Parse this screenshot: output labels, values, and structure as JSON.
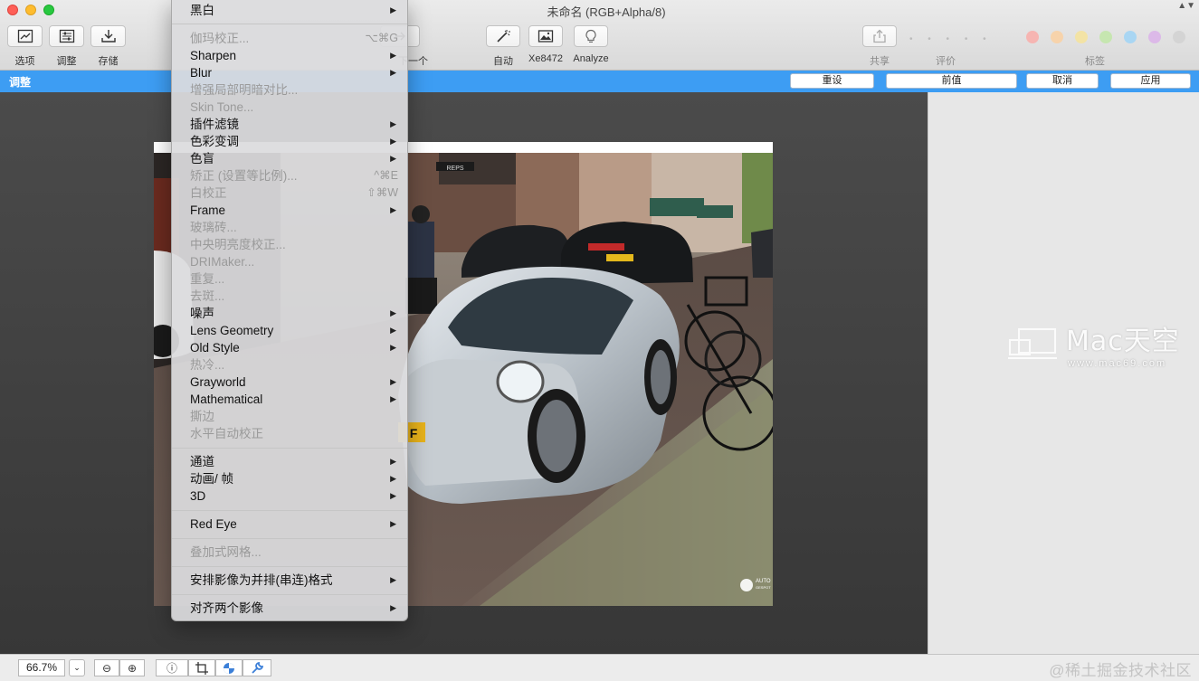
{
  "window": {
    "title": "未命名 (RGB+Alpha/8)",
    "scroll_arrows": "▲▼"
  },
  "toolbar": {
    "options_label": "选项",
    "adjust_label": "调整",
    "save_label": "存储",
    "next_label": "下一个",
    "auto_label": "自动",
    "xe_label": "Xe8472",
    "analyze_label": "Analyze",
    "share_label": "共享",
    "rating_label": "评价",
    "rating_dots": "• • • • •",
    "tags_label": "标签",
    "tag_colors": [
      "#f6b5b2",
      "#f7d3ab",
      "#f3e3a5",
      "#c6e6b0",
      "#a9d6f3",
      "#dcb9e8",
      "#d4d4d4"
    ]
  },
  "adjust_bar": {
    "title": "调整",
    "reset_label": "重设",
    "previous_label": "前值",
    "cancel_label": "取消",
    "apply_label": "应用"
  },
  "menu": {
    "items": [
      {
        "label": "黑白",
        "arrow": "▶",
        "disabled": false
      },
      {
        "label": "伽玛校正...",
        "shortcut": "⌥⌘G",
        "disabled": true
      },
      {
        "label": "Sharpen",
        "arrow": "▶",
        "disabled": false
      },
      {
        "label": "Blur",
        "arrow": "▶",
        "disabled": false
      },
      {
        "label": "增强局部明暗对比...",
        "disabled": true
      },
      {
        "label": "Skin Tone...",
        "disabled": true
      },
      {
        "label": "插件滤镜",
        "arrow": "▶",
        "disabled": false
      },
      {
        "label": "色彩变调",
        "arrow": "▶",
        "disabled": false
      },
      {
        "label": "色盲",
        "arrow": "▶",
        "disabled": false
      },
      {
        "label": "矫正 (设置等比例)...",
        "shortcut": "^⌘E",
        "disabled": true
      },
      {
        "label": "白校正",
        "shortcut": "⇧⌘W",
        "disabled": true
      },
      {
        "label": "Frame",
        "arrow": "▶",
        "disabled": false
      },
      {
        "label": "玻璃砖...",
        "disabled": true
      },
      {
        "label": "中央明亮度校正...",
        "disabled": true
      },
      {
        "label": "DRIMaker...",
        "disabled": true
      },
      {
        "label": "重复...",
        "disabled": true
      },
      {
        "label": "去斑...",
        "disabled": true
      },
      {
        "label": "噪声",
        "arrow": "▶",
        "disabled": false
      },
      {
        "label": "Lens Geometry",
        "arrow": "▶",
        "disabled": false
      },
      {
        "label": "Old Style",
        "arrow": "▶",
        "disabled": false
      },
      {
        "label": "热冷...",
        "disabled": true
      },
      {
        "label": "Grayworld",
        "arrow": "▶",
        "disabled": false
      },
      {
        "label": "Mathematical",
        "arrow": "▶",
        "disabled": false
      },
      {
        "label": "撕边",
        "disabled": true
      },
      {
        "label": "水平自动校正",
        "disabled": true
      },
      {
        "label": "通道",
        "arrow": "▶",
        "disabled": false
      },
      {
        "label": "动画/ 帧",
        "arrow": "▶",
        "disabled": false
      },
      {
        "label": "3D",
        "arrow": "▶",
        "disabled": false
      },
      {
        "label": "Red Eye",
        "arrow": "▶",
        "disabled": false
      },
      {
        "label": "叠加式网格...",
        "disabled": true
      },
      {
        "label": "安排影像为并排(串连)格式",
        "arrow": "▶",
        "disabled": false
      },
      {
        "label": "对齐两个影像",
        "arrow": "▶",
        "disabled": false
      }
    ]
  },
  "canvas": {
    "plate_text": "F",
    "photo_brand": "AUTO",
    "photo_brand_sub": "GESPOT",
    "shop_sign": "REPS"
  },
  "side_panel": {
    "watermark_main": "Mac天空",
    "watermark_sub": "www.mac69.com"
  },
  "bottom_bar": {
    "zoom": "66.7%",
    "zoom_dropdown": "⌄",
    "zoom_out_icon": "⊖",
    "zoom_in_icon": "⊕",
    "info_icon": "ⓘ",
    "credit": "@稀土掘金技术社区"
  }
}
